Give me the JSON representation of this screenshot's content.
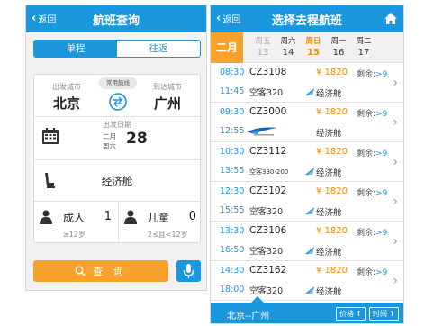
{
  "left": {
    "back_label": "返回",
    "title": "航班查询",
    "tabs": [
      {
        "label": "单程",
        "active": true
      },
      {
        "label": "往返",
        "active": false
      }
    ],
    "from": {
      "caption": "出发城市",
      "city": "北京"
    },
    "to": {
      "caption": "到达城市",
      "city": "广州"
    },
    "common_routes": "常用航线",
    "date": {
      "caption": "出发日期",
      "month": "二月",
      "weekday": "周六",
      "day": "28"
    },
    "cabin": "经济舱",
    "adult": {
      "label": "成人",
      "count": "1",
      "age": "≥12岁"
    },
    "child": {
      "label": "儿童",
      "count": "0",
      "age": "2≤且<12岁"
    },
    "search_label": "查 询",
    "icons": [
      "back-chevron-icon",
      "swap-icon",
      "calendar-icon",
      "seat-icon",
      "person-icon",
      "search-icon",
      "microphone-icon"
    ],
    "colors": {
      "primary": "#1a97dd",
      "accent": "#f8a12c"
    }
  },
  "right": {
    "back_label": "返回",
    "title": "选择去程航班",
    "month": "二月",
    "days": [
      {
        "weekday": "周五",
        "date": "13",
        "state": "past"
      },
      {
        "weekday": "周六",
        "date": "14",
        "state": "normal"
      },
      {
        "weekday": "周日",
        "date": "15",
        "state": "selected"
      },
      {
        "weekday": "周一",
        "date": "16",
        "state": "normal"
      },
      {
        "weekday": "周二",
        "date": "17",
        "state": "normal"
      }
    ],
    "flights": [
      {
        "dep": "08:30",
        "arr": "11:45",
        "no": "CZ3108",
        "craft": "空客320",
        "price": "¥ 1820",
        "cabin": "经济舱",
        "remain_label": "剩余:",
        "remain": ">9"
      },
      {
        "dep": "09:30",
        "arr": "12:55",
        "no": "CZ3000",
        "craft": "",
        "price": "¥ 1820",
        "cabin": "经济舱",
        "remain_label": "剩余:",
        "remain": ">9"
      },
      {
        "dep": "10:30",
        "arr": "13:55",
        "no": "CZ3112",
        "craft": "空客330-200",
        "price": "¥ 1820",
        "cabin": "经济舱",
        "remain_label": "剩余:",
        "remain": ">9"
      },
      {
        "dep": "12:30",
        "arr": "15:55",
        "no": "CZ3102",
        "craft": "空客320",
        "price": "¥ 1820",
        "cabin": "经济舱",
        "remain_label": "剩余:",
        "remain": ">9"
      },
      {
        "dep": "13:30",
        "arr": "16:50",
        "no": "CZ3106",
        "craft": "空客320",
        "price": "¥ 1820",
        "cabin": "经济舱",
        "remain_label": "剩余:",
        "remain": ">9"
      },
      {
        "dep": "14:30",
        "arr": "18:00",
        "no": "CZ3162",
        "craft": "空客320",
        "price": "¥ 1820",
        "cabin": "经济舱",
        "remain_label": "剩余:",
        "remain": ">9"
      }
    ],
    "footer": {
      "route": "北京--广州",
      "sort_price": "价格",
      "sort_time": "时间"
    },
    "icons": [
      "back-chevron-icon",
      "home-icon",
      "airline-logo-icon",
      "airline-tail-icon",
      "chevron-right-icon",
      "sort-up-icon"
    ]
  }
}
